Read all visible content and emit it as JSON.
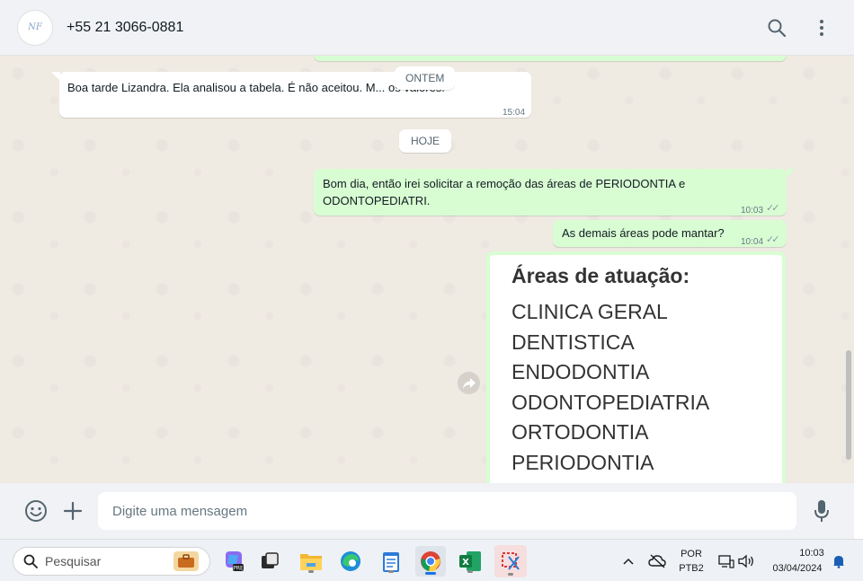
{
  "header": {
    "contact_name": "+55 21 3066-0881",
    "avatar_text": "NF"
  },
  "chat": {
    "date_divider_ontem": "ONTEM",
    "date_divider_hoje": "HOJE",
    "messages": [
      {
        "direction": "in",
        "text": "Boa tarde Lizandra. Ela analisou a tabela. É não  aceitou. M... os valores.",
        "time": "15:04"
      },
      {
        "direction": "out",
        "line1": "Bom dia, então irei solicitar a remoção das áreas de PERIODONTIA e",
        "line2": "ODONTOPEDIATRI.",
        "time": "10:03",
        "status": "read"
      },
      {
        "direction": "out",
        "text": "As demais áreas pode mantar?",
        "time": "10:04",
        "status": "read"
      }
    ],
    "image_message": {
      "title": "Áreas de atuação:",
      "lines": [
        "CLINICA GERAL",
        "DENTISTICA",
        "ENDODONTIA",
        "ODONTOPEDIATRIA",
        "ORTODONTIA",
        "PERIODONTIA"
      ]
    }
  },
  "composer": {
    "placeholder": "Digite uma mensagem"
  },
  "taskbar": {
    "search_placeholder": "Pesquisar",
    "language": "POR",
    "keyboard": "PTB2",
    "time": "10:03",
    "date": "03/04/2024"
  },
  "colors": {
    "incoming_bubble": "#ffffff",
    "outgoing_bubble": "#d9fdd3",
    "chat_background": "#efeae2",
    "header_background": "#f0f2f5",
    "read_ticks": "#8696a0"
  }
}
